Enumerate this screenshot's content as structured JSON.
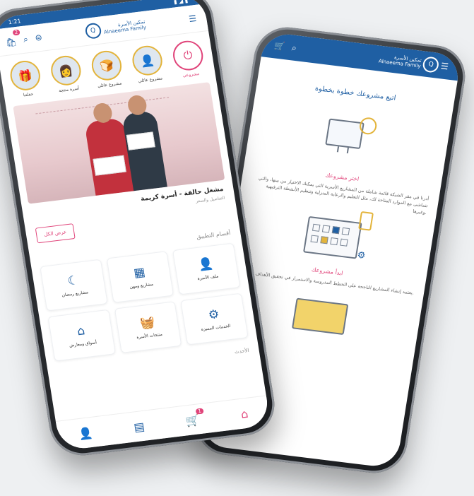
{
  "left_phone": {
    "status": {
      "time": "1:21",
      "indicators": "▮ ◢ ▮"
    },
    "header": {
      "cart_badge": "2",
      "logo_text_line1": "تمكين الأسرة",
      "logo_text_line2": "Alnaeema Family"
    },
    "stories": [
      {
        "label": "مشروعي",
        "icon": "power-icon",
        "active": true
      },
      {
        "label": "مشروع عائلي",
        "icon": "avatar",
        "active": false
      },
      {
        "label": "مشروع عائلي",
        "icon": "avatar",
        "active": false
      },
      {
        "label": "أسرة منتجة",
        "icon": "avatar",
        "active": false
      },
      {
        "label": "حفلتنا",
        "icon": "avatar",
        "active": false
      }
    ],
    "program": {
      "title": "مشغل حالقة - أسرة كريمة",
      "meta": "التفاصيل والسعر",
      "more_label": "عرض الكل"
    },
    "section_title": "أقسام التطبيق",
    "tiles": [
      {
        "label": "مشاريع رمضان",
        "icon": "moon-icon"
      },
      {
        "label": "مشاريع ومهن",
        "icon": "workshop-icon"
      },
      {
        "label": "ملف الأسرة",
        "icon": "user-icon"
      },
      {
        "label": "أسواق ومعارض",
        "icon": "store-icon"
      },
      {
        "label": "منتجات الأسرة",
        "icon": "basket-icon"
      },
      {
        "label": "الخدمات المميزة",
        "icon": "service-icon"
      }
    ],
    "latest_label": "الأحدث",
    "bottom_nav": [
      "home-icon",
      "cart-icon",
      "orders-icon",
      "profile-icon"
    ],
    "bottom_cart_badge": "1"
  },
  "right_phone": {
    "header": {
      "logo_text_line1": "تمكين الأسرة",
      "logo_text_line2": "Alnaeema Family"
    },
    "title": "اتبع مشروعك خطوة بخطوة",
    "step1": {
      "title": "اختر مشروعك",
      "text": "أدرنا في مقر الشبكة قائمة شاملة من المشاريع الأسرية التي يمكنك الاختيار من بينها، والتي تتماشى مع الموارد المتاحة لك، مثل التعليم والرعاية المنزلية وتنظيم الأنشطة الترفيهية وغيرها."
    },
    "step2": {
      "title": "ابدأ مشروعك",
      "text": "يعتمد إنشاء المشاريع الناجحة على الخطط المدروسة والاستمرار في تحقيق الأهداف."
    }
  },
  "colors": {
    "primary": "#1f5fa3",
    "accent": "#e0447a",
    "gold": "#e3b43b",
    "background": "#eef0f2"
  }
}
